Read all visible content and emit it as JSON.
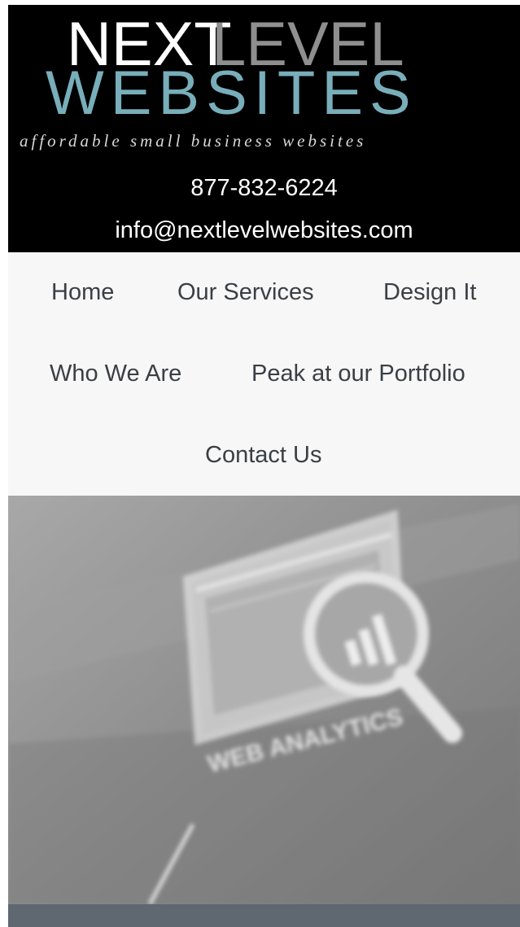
{
  "brand": {
    "logo_word_next": "NEXT",
    "logo_word_level": "LEVEL",
    "logo_word_websites": "WEBSITES",
    "tagline": "affordable small business websites",
    "phone": "877-832-6224",
    "email": "info@nextlevelwebsites.com"
  },
  "nav": {
    "items": [
      {
        "label": "Home"
      },
      {
        "label": "Our Services"
      },
      {
        "label": "Design It"
      },
      {
        "label": "Who We Are"
      },
      {
        "label": "Peak at our Portfolio"
      },
      {
        "label": "Contact Us"
      }
    ]
  },
  "hero": {
    "image_label": "WEB ANALYTICS"
  },
  "colors": {
    "header_bg": "#000000",
    "nav_bg": "#f7f7f7",
    "nav_text": "#3a3f44",
    "logo_white": "#ffffff",
    "logo_teal": "#78aeba",
    "logo_gray": "#8f8f8f",
    "hero_bg": "#8f8f8f",
    "bottom_bar": "#5f6771"
  }
}
